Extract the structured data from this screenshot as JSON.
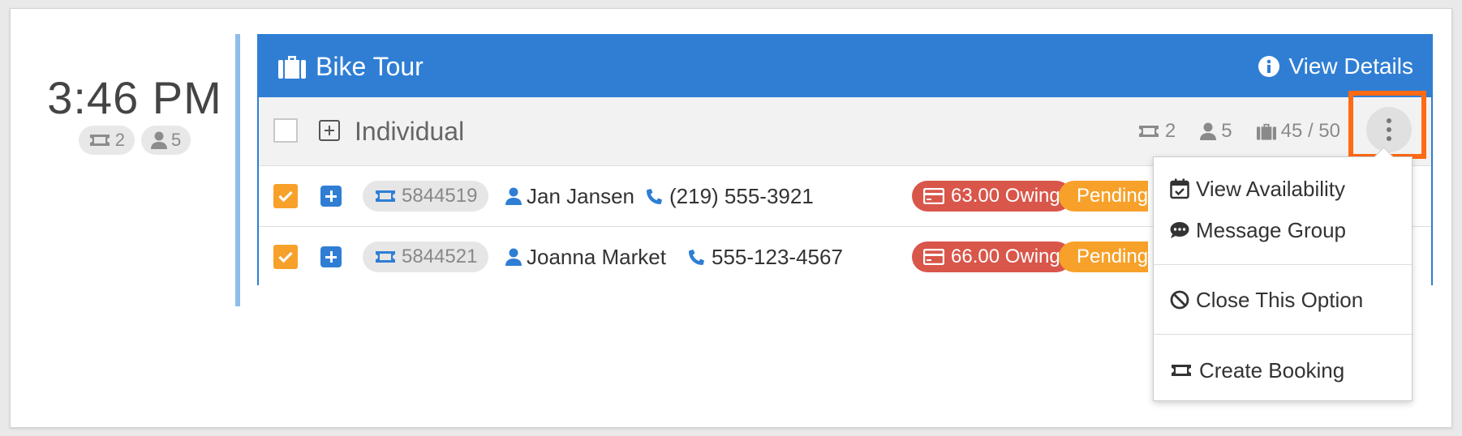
{
  "slot": {
    "time": "3:46 PM",
    "tickets": "2",
    "guests": "5"
  },
  "tour": {
    "title": "Bike Tour",
    "view_details": "View Details"
  },
  "group": {
    "name": "Individual",
    "tickets": "2",
    "guests": "5",
    "capacity": "45 / 50"
  },
  "bookings": [
    {
      "id": "5844519",
      "name": "Jan Jansen",
      "phone": "(219) 555-3921",
      "owing": "63.00 Owing",
      "status": "Pending",
      "checked": true
    },
    {
      "id": "5844521",
      "name": "Joanna Market",
      "phone": "555-123-4567",
      "owing": "66.00 Owing",
      "status": "Pending",
      "checked": true
    }
  ],
  "menu": {
    "items": [
      {
        "label": "View Availability",
        "icon": "calendar-check-icon"
      },
      {
        "label": "Message Group",
        "icon": "comment-dots-icon"
      },
      {
        "label": "Close This Option",
        "icon": "ban-icon"
      },
      {
        "label": "Create Booking",
        "icon": "ticket-icon"
      }
    ]
  },
  "colors": {
    "primary": "#2f7ed4",
    "owing": "#d9564a",
    "pending": "#f7a12a",
    "highlight": "#ff6a13"
  }
}
